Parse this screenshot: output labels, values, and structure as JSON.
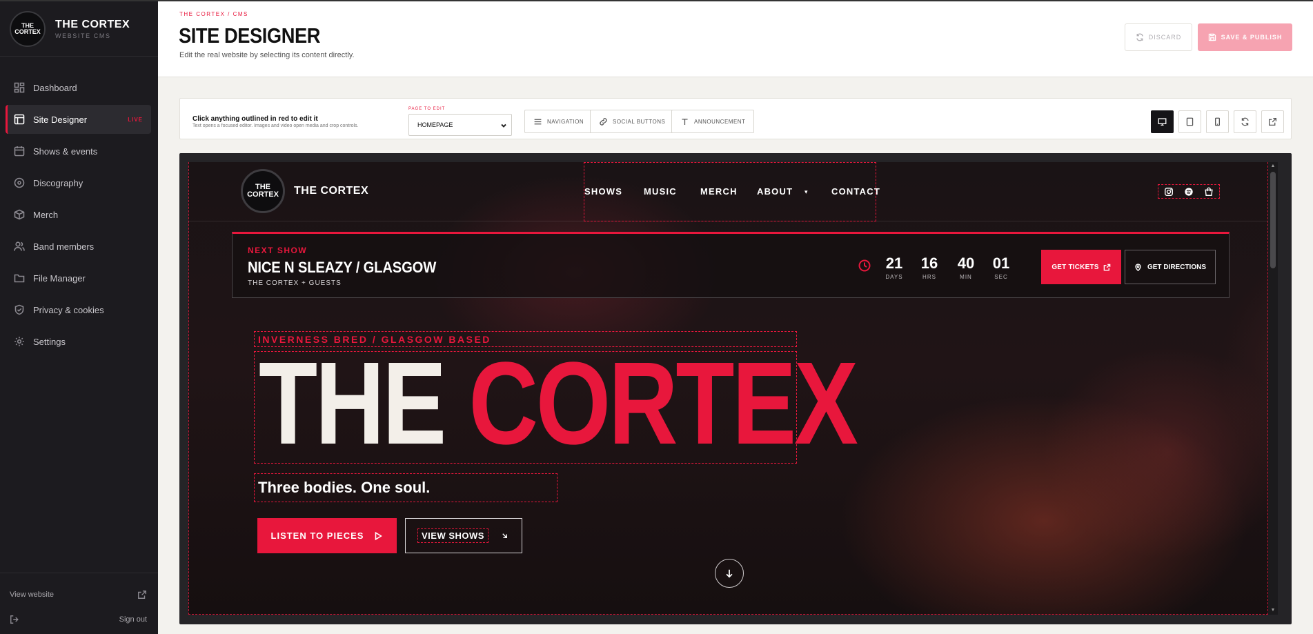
{
  "brand": {
    "logo_text": "THE CORTEX",
    "name": "THE CORTEX",
    "subtitle": "WEBSITE CMS"
  },
  "sidebar": {
    "items": [
      {
        "label": "Dashboard",
        "icon": "dashboard-icon"
      },
      {
        "label": "Site Designer",
        "icon": "layout-icon",
        "badge": "LIVE",
        "active": true
      },
      {
        "label": "Shows & events",
        "icon": "calendar-icon"
      },
      {
        "label": "Discography",
        "icon": "disc-icon"
      },
      {
        "label": "Merch",
        "icon": "box-icon"
      },
      {
        "label": "Band members",
        "icon": "users-icon"
      },
      {
        "label": "File Manager",
        "icon": "folder-icon"
      },
      {
        "label": "Privacy & cookies",
        "icon": "shield-icon"
      },
      {
        "label": "Settings",
        "icon": "gear-icon"
      }
    ],
    "footer": {
      "view_website": "View website",
      "sign_out": "Sign out"
    }
  },
  "header": {
    "breadcrumb": "THE CORTEX / CMS",
    "title": "SITE DESIGNER",
    "subtitle": "Edit the real website by selecting its content directly.",
    "discard_label": "DISCARD",
    "publish_label": "SAVE & PUBLISH"
  },
  "toolbar": {
    "hint_title": "Click anything outlined in red to edit it",
    "hint_sub": "Text opens a focused editor. Images and video open media and crop controls.",
    "page_label": "PAGE TO EDIT",
    "page_value": "HOMEPAGE",
    "buttons": [
      "NAVIGATION",
      "SOCIAL BUTTONS",
      "ANNOUNCEMENT"
    ],
    "devices": [
      "desktop-icon",
      "tablet-icon",
      "mobile-icon",
      "refresh-icon",
      "external-link-icon"
    ]
  },
  "site": {
    "logo_text": "THE CORTEX",
    "name": "THE CORTEX",
    "menu": [
      "SHOWS",
      "MUSIC",
      "MERCH",
      "ABOUT",
      "CONTACT"
    ],
    "social": [
      "instagram-icon",
      "spotify-icon",
      "bag-icon"
    ],
    "next_show": {
      "label": "NEXT SHOW",
      "title": "NICE N SLEAZY / GLASGOW",
      "sub": "THE CORTEX + GUESTS",
      "countdown": [
        {
          "value": "21",
          "unit": "DAYS"
        },
        {
          "value": "16",
          "unit": "HRS"
        },
        {
          "value": "40",
          "unit": "MIN"
        },
        {
          "value": "01",
          "unit": "SEC"
        }
      ],
      "tickets_label": "GET TICKETS",
      "directions_label": "GET DIRECTIONS"
    },
    "hero": {
      "tagline": "INVERNESS BRED / GLASGOW BASED",
      "title_first": "THE",
      "title_second": "CORTEX",
      "slogan": "Three bodies. One soul.",
      "listen_label": "LISTEN TO PIECES",
      "view_label": "VIEW SHOWS"
    }
  },
  "colors": {
    "accent": "#e8173c",
    "sidebar_bg": "#1c1b1f",
    "publish_disabled": "#f6a3b1"
  }
}
